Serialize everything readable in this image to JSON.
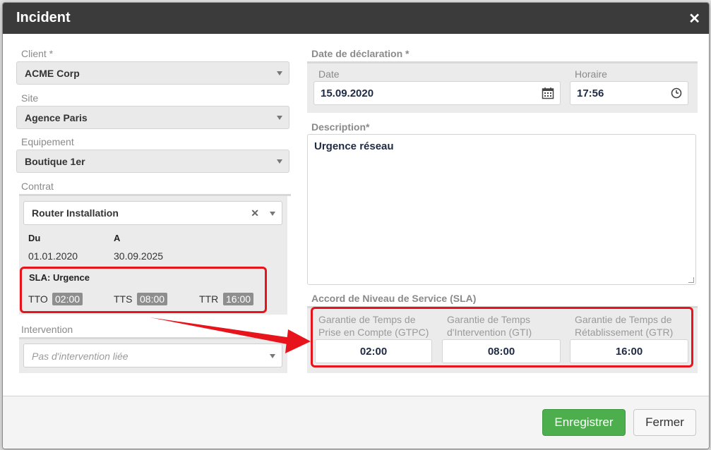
{
  "dialog": {
    "title": "Incident",
    "close_icon": "close-icon"
  },
  "left": {
    "client": {
      "label": "Client *",
      "value": "ACME Corp"
    },
    "site": {
      "label": "Site",
      "value": "Agence Paris"
    },
    "equipement": {
      "label": "Equipement",
      "value": "Boutique 1er"
    },
    "contrat": {
      "label": "Contrat",
      "value": "Router Installation",
      "du_label": "Du",
      "a_label": "A",
      "du_value": "01.01.2020",
      "a_value": "30.09.2025",
      "sla_title": "SLA: Urgence",
      "tto_label": "TTO",
      "tto_value": "02:00",
      "tts_label": "TTS",
      "tts_value": "08:00",
      "ttr_label": "TTR",
      "ttr_value": "16:00"
    },
    "intervention": {
      "label": "Intervention",
      "placeholder": "Pas d'intervention liée"
    }
  },
  "right": {
    "declaration": {
      "label": "Date de déclaration *",
      "date_label": "Date",
      "date_value": "15.09.2020",
      "time_label": "Horaire",
      "time_value": "17:56"
    },
    "description": {
      "label": "Description*",
      "value": "Urgence réseau"
    },
    "sla": {
      "label": "Accord de Niveau de Service (SLA)",
      "gtpc_label": "Garantie de Temps de Prise en Compte (GTPC)",
      "gtpc_value": "02:00",
      "gti_label": "Garantie de Temps d'Intervention (GTI)",
      "gti_value": "08:00",
      "gtr_label": "Garantie de Temps de Rétablissement (GTR)",
      "gtr_value": "16:00"
    }
  },
  "footer": {
    "save_label": "Enregistrer",
    "close_label": "Fermer"
  },
  "colors": {
    "header": "#3b3b3b",
    "save": "#4cae4c",
    "highlight": "#e8141b"
  }
}
